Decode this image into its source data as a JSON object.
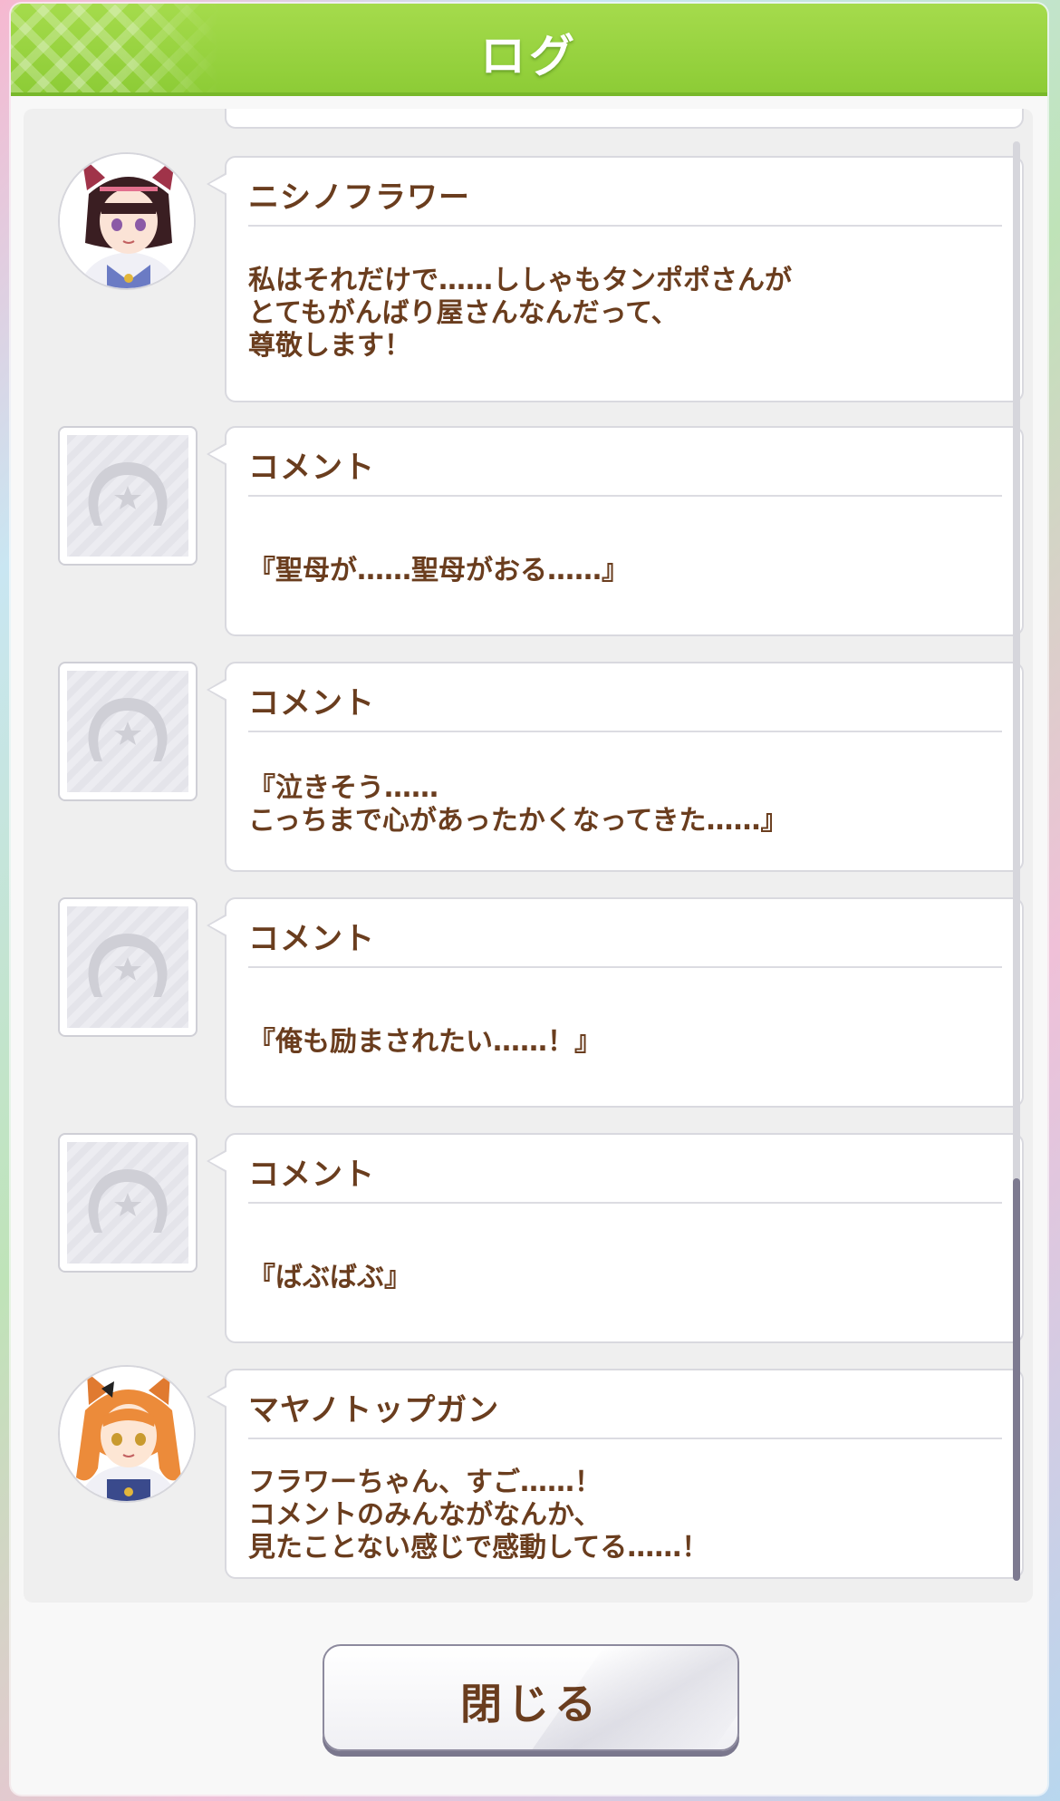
{
  "header": {
    "title": "ログ"
  },
  "entries": [
    {
      "speaker": "ニシノフラワー",
      "avatar": "character-portrait",
      "message": "私はそれだけで……ししゃもタンポポさんが\nとてもがんばり屋さんなんだって、\n尊敬します！"
    },
    {
      "speaker": "コメント",
      "avatar": "horseshoe-icon",
      "message": "『聖母が……聖母がおる……』"
    },
    {
      "speaker": "コメント",
      "avatar": "horseshoe-icon",
      "message": "『泣きそう……\nこっちまで心があったかくなってきた……』"
    },
    {
      "speaker": "コメント",
      "avatar": "horseshoe-icon",
      "message": "『俺も励まされたい……！』"
    },
    {
      "speaker": "コメント",
      "avatar": "horseshoe-icon",
      "message": "『ばぶばぶ』"
    },
    {
      "speaker": "マヤノトップガン",
      "avatar": "character-portrait",
      "message": "フラワーちゃん、すご……！\nコメントのみんながなんか、\n見たことない感じで感動してる……！"
    }
  ],
  "close_button": {
    "label": "閉じる"
  },
  "colors": {
    "header_green": "#8dcc36",
    "text_brown": "#6a3d1e",
    "scroll_thumb": "#7d7a90"
  }
}
